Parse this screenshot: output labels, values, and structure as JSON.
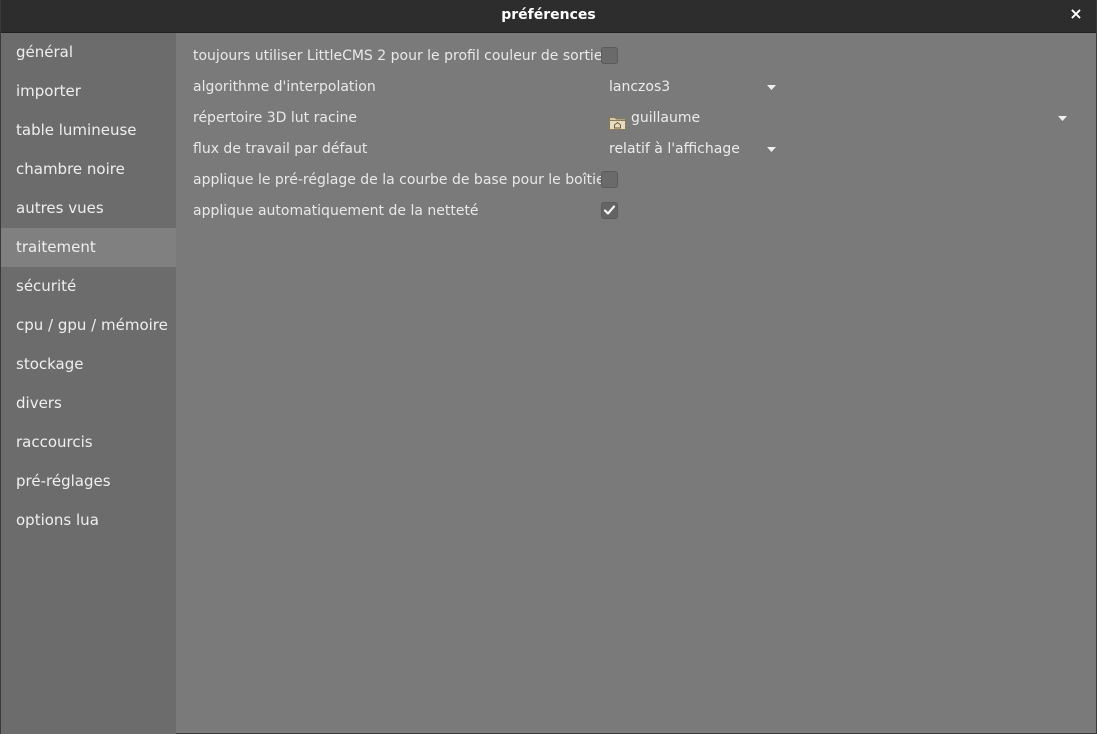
{
  "window": {
    "title": "préférences",
    "close_icon": "×"
  },
  "sidebar": {
    "items": [
      {
        "label": "général"
      },
      {
        "label": "importer"
      },
      {
        "label": "table lumineuse"
      },
      {
        "label": "chambre noire"
      },
      {
        "label": "autres vues"
      },
      {
        "label": "traitement"
      },
      {
        "label": "sécurité"
      },
      {
        "label": "cpu / gpu / mémoire"
      },
      {
        "label": "stockage"
      },
      {
        "label": "divers"
      },
      {
        "label": "raccourcis"
      },
      {
        "label": "pré-réglages"
      },
      {
        "label": "options lua"
      }
    ],
    "active": "traitement"
  },
  "settings": {
    "littlecms_label": "toujours utiliser LittleCMS 2 pour le profil couleur de sortie",
    "littlecms_checked": false,
    "interpolation_label": "algorithme d'interpolation",
    "interpolation_value": "lanczos3",
    "lut_label": "répertoire 3D lut racine",
    "lut_value": "guillaume",
    "workflow_label": "flux de travail par défaut",
    "workflow_value": "relatif à l'affichage",
    "base_curve_label": "applique le pré-réglage de la courbe de base pour le boîtier",
    "base_curve_checked": false,
    "sharpen_label": "applique automatiquement de la netteté",
    "sharpen_checked": true
  },
  "icons": {
    "close": "close-icon",
    "dropdown": "chevron-down-icon",
    "folder": "home-folder-icon",
    "check": "checkmark-icon"
  },
  "colors": {
    "titlebar": "#2d2d2d",
    "sidebar": "#6c6c6c",
    "sidebar_active": "#808080",
    "content": "#7a7a7a",
    "text": "#e9e9e9"
  }
}
